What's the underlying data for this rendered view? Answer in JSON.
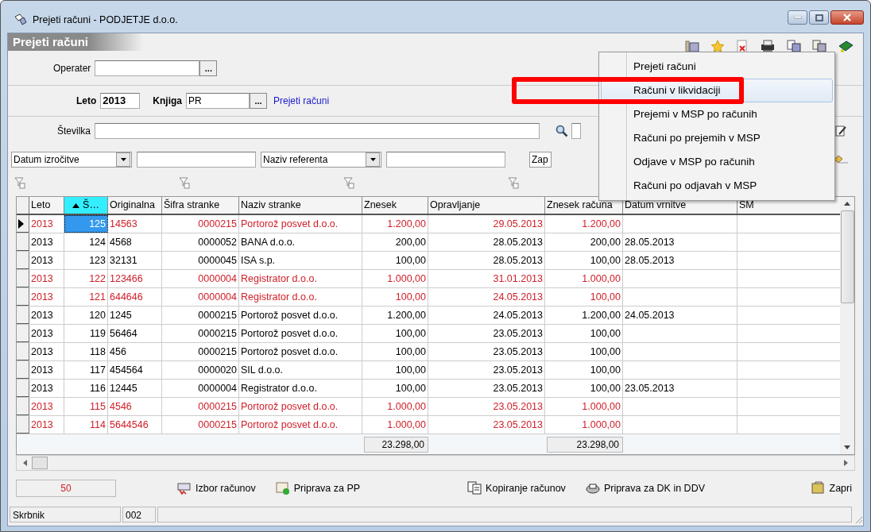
{
  "window": {
    "title": "Prejeti računi - PODJETJE d.o.o."
  },
  "header": {
    "title": "Prejeti računi"
  },
  "filters": {
    "operater": {
      "label": "Operater",
      "button": "..."
    },
    "leto": {
      "label": "Leto",
      "value": "2013"
    },
    "knjiga": {
      "label": "Knjiga",
      "value": "PR",
      "button": "...",
      "link": "Prejeti računi"
    },
    "stevilka": {
      "label": "Številka"
    },
    "combos": [
      {
        "value": "Datum izročitve"
      },
      {
        "value": "Naziv referenta"
      },
      {
        "value": "Zap"
      }
    ]
  },
  "menu": {
    "items": [
      {
        "label": "Prejeti računi",
        "selected": false
      },
      {
        "label": "Računi v likvidaciji",
        "selected": true
      },
      {
        "label": "Prejemi v MSP po računih",
        "selected": false
      },
      {
        "label": "Računi po prejemih v MSP",
        "selected": false
      },
      {
        "label": "Odjave v MSP po računih",
        "selected": false
      },
      {
        "label": "Računi po odjavah v MSP",
        "selected": false
      }
    ]
  },
  "table": {
    "columns": [
      {
        "label": "Leto",
        "sorted": false
      },
      {
        "label": "Š…",
        "sorted": true
      },
      {
        "label": "Originalna",
        "sorted": false
      },
      {
        "label": "Šifra stranke",
        "sorted": false
      },
      {
        "label": "Naziv stranke",
        "sorted": false
      },
      {
        "label": "Znesek",
        "sorted": false,
        "total": "23.298,00"
      },
      {
        "label": "Opravljanje",
        "sorted": false
      },
      {
        "label": "Znesek računa",
        "sorted": false,
        "total": "23.298,00"
      },
      {
        "label": "Datum vrnitve",
        "sorted": false
      },
      {
        "label": "SM",
        "sorted": false
      }
    ],
    "rows": [
      {
        "flagged": true,
        "selected": true,
        "cells": [
          "2013",
          "125",
          "14563",
          "0000215",
          "Portorož posvet d.o.o.",
          "1.200,00",
          "29.05.2013",
          "1.200,00",
          "",
          ""
        ]
      },
      {
        "flagged": false,
        "selected": false,
        "cells": [
          "2013",
          "124",
          "4568",
          "0000052",
          "BANA d.o.o.",
          "200,00",
          "28.05.2013",
          "200,00",
          "28.05.2013",
          ""
        ]
      },
      {
        "flagged": false,
        "selected": false,
        "cells": [
          "2013",
          "123",
          "32131",
          "0000045",
          "ISA s.p.",
          "100,00",
          "28.05.2013",
          "100,00",
          "28.05.2013",
          ""
        ]
      },
      {
        "flagged": true,
        "selected": false,
        "cells": [
          "2013",
          "122",
          "123466",
          "0000004",
          "Registrator d.o.o.",
          "1.000,00",
          "31.01.2013",
          "1.000,00",
          "",
          ""
        ]
      },
      {
        "flagged": true,
        "selected": false,
        "cells": [
          "2013",
          "121",
          "644646",
          "0000004",
          "Registrator d.o.o.",
          "100,00",
          "24.05.2013",
          "100,00",
          "",
          ""
        ]
      },
      {
        "flagged": false,
        "selected": false,
        "cells": [
          "2013",
          "120",
          "1245",
          "0000215",
          "Portorož posvet d.o.o.",
          "1.200,00",
          "24.05.2013",
          "1.200,00",
          "24.05.2013",
          ""
        ]
      },
      {
        "flagged": false,
        "selected": false,
        "cells": [
          "2013",
          "119",
          "56464",
          "0000215",
          "Portorož posvet d.o.o.",
          "100,00",
          "23.05.2013",
          "100,00",
          "",
          ""
        ]
      },
      {
        "flagged": false,
        "selected": false,
        "cells": [
          "2013",
          "118",
          "456",
          "0000215",
          "Portorož posvet d.o.o.",
          "100,00",
          "23.05.2013",
          "100,00",
          "",
          ""
        ]
      },
      {
        "flagged": false,
        "selected": false,
        "cells": [
          "2013",
          "117",
          "454564",
          "0000020",
          "SIL d.o.o.",
          "100,00",
          "23.05.2013",
          "100,00",
          "",
          ""
        ]
      },
      {
        "flagged": false,
        "selected": false,
        "cells": [
          "2013",
          "116",
          "12445",
          "0000004",
          "Registrator d.o.o.",
          "100,00",
          "23.05.2013",
          "100,00",
          "23.05.2013",
          ""
        ]
      },
      {
        "flagged": true,
        "selected": false,
        "cells": [
          "2013",
          "115",
          "4546",
          "0000215",
          "Portorož posvet d.o.o.",
          "1.000,00",
          "23.05.2013",
          "1.000,00",
          "",
          ""
        ]
      },
      {
        "flagged": true,
        "selected": false,
        "cells": [
          "2013",
          "114",
          "5644546",
          "0000215",
          "Portorož posvet d.o.o.",
          "1.000,00",
          "23.05.2013",
          "1.000,00",
          "",
          ""
        ]
      }
    ]
  },
  "buttons": [
    {
      "label": "Izbor računov",
      "kind": "select"
    },
    {
      "label": "Priprava za PP",
      "kind": "prepare"
    },
    {
      "label": "Kopiranje računov",
      "kind": "copy"
    },
    {
      "label": "Priprava za DK in DDV",
      "kind": "print"
    },
    {
      "label": "Zapri",
      "kind": "close"
    }
  ],
  "status_bar": {
    "count": "50",
    "user": "Skrbnik",
    "code": "002"
  }
}
